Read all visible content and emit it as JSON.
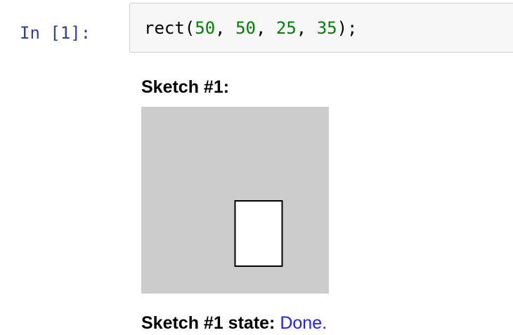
{
  "cell": {
    "prompt": "In [1]:",
    "code": {
      "func": "rect(",
      "a1": "50",
      "sep1": ", ",
      "a2": "50",
      "sep2": ", ",
      "a3": "25",
      "sep3": ", ",
      "a4": "35",
      "end": ");"
    }
  },
  "output": {
    "sketch_title": "Sketch #1:",
    "state_label": "Sketch #1 state:",
    "state_value": "Done."
  },
  "sketch": {
    "background_color": "#cccccc",
    "rect_fill": "#ffffff",
    "rect_stroke": "#000000"
  },
  "colors": {
    "prompt": "#303f9f",
    "number": "#008000",
    "state_value": "#2020ff"
  }
}
